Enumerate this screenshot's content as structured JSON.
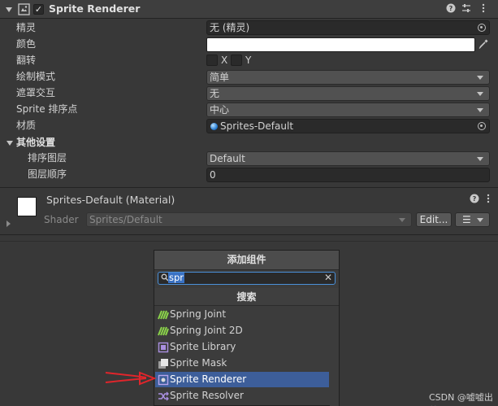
{
  "component": {
    "title": "Sprite Renderer",
    "enabled_check": "✓",
    "icons": [
      "help-icon",
      "presets-icon",
      "more-menu-icon"
    ]
  },
  "properties": {
    "sprite": {
      "label": "精灵",
      "value": "无 (精灵)"
    },
    "color": {
      "label": "颜色",
      "value": "#ffffff"
    },
    "flip": {
      "label": "翻转",
      "x_label": "X",
      "y_label": "Y"
    },
    "draw_mode": {
      "label": "绘制模式",
      "value": "简单"
    },
    "mask_interaction": {
      "label": "遮罩交互",
      "value": "无"
    },
    "sort_point": {
      "label": "Sprite 排序点",
      "value": "中心"
    },
    "material": {
      "label": "材质",
      "value": "Sprites-Default"
    }
  },
  "additional_settings": {
    "label": "其他设置",
    "sorting_layer": {
      "label": "排序图层",
      "value": "Default"
    },
    "order_in_layer": {
      "label": "图层顺序",
      "value": "0"
    }
  },
  "material_section": {
    "title": "Sprites-Default (Material)",
    "shader_label": "Shader",
    "shader_value": "Sprites/Default",
    "edit_button": "Edit...",
    "list_button": "☰"
  },
  "add_component": {
    "title": "添加组件",
    "search_value": "spr",
    "clear": "✕",
    "section": "搜索",
    "results": [
      {
        "label": "Spring Joint",
        "icon": "spring-joint-icon",
        "selected": false
      },
      {
        "label": "Spring Joint 2D",
        "icon": "spring-joint-2d-icon",
        "selected": false
      },
      {
        "label": "Sprite Library",
        "icon": "sprite-library-icon",
        "selected": false
      },
      {
        "label": "Sprite Mask",
        "icon": "sprite-mask-icon",
        "selected": false
      },
      {
        "label": "Sprite Renderer",
        "icon": "sprite-renderer-icon",
        "selected": true
      },
      {
        "label": "Sprite Resolver",
        "icon": "sprite-resolver-icon",
        "selected": false
      }
    ]
  },
  "watermark": "CSDN @嘘嘘出差",
  "colors": {
    "annotation_arrow": "#e0252b",
    "selection": "#3d5e9a",
    "search_highlight": "#3a72c4"
  }
}
